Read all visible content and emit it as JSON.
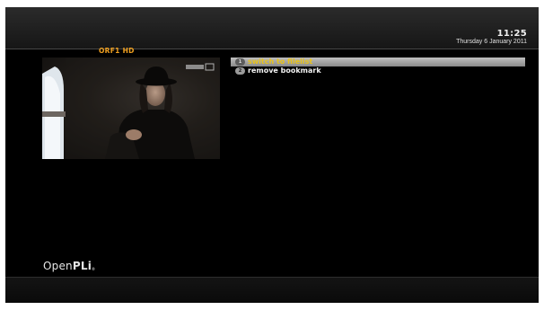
{
  "header": {
    "time": "11:25",
    "date": "Thursday 6 January 2011"
  },
  "preview": {
    "channel": "ORF1 HD"
  },
  "menu": {
    "items": [
      {
        "key": "1",
        "label": "switch to filelist",
        "selected": true
      },
      {
        "key": "2",
        "label": "remove bookmark",
        "selected": false
      }
    ]
  },
  "branding": {
    "logo_light": "Open",
    "logo_bold": "PLi",
    "logo_mark": "®"
  },
  "colors": {
    "accent_channel": "#f0a020",
    "selected_text": "#e8c31a"
  }
}
